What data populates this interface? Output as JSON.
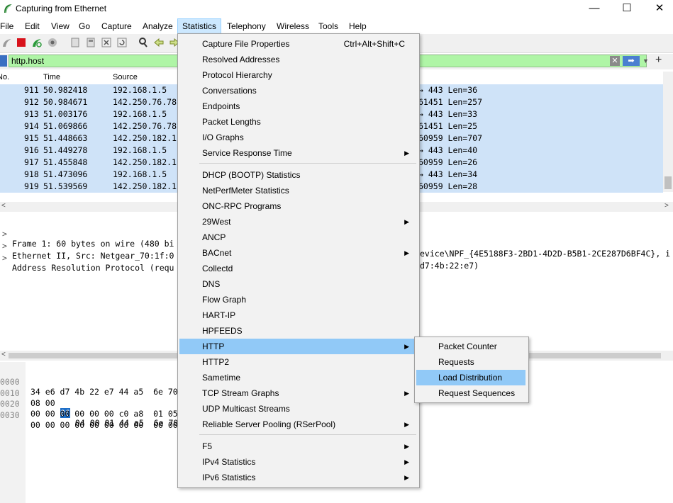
{
  "window": {
    "title": "Capturing from Ethernet",
    "minimize": "—",
    "maximize": "☐",
    "close": "✕"
  },
  "menubar": [
    "File",
    "Edit",
    "View",
    "Go",
    "Capture",
    "Analyze",
    "Statistics",
    "Telephony",
    "Wireless",
    "Tools",
    "Help"
  ],
  "filter": {
    "value": "http.host",
    "plus": "+"
  },
  "packet_list": {
    "headers": [
      "No.",
      "Time",
      "Source"
    ],
    "rows": [
      {
        "no": "911",
        "time": "50.982418",
        "src": "192.168.1.5",
        "info": "→ 443 Len=36"
      },
      {
        "no": "912",
        "time": "50.984671",
        "src": "142.250.76.78",
        "info": "61451 Len=257"
      },
      {
        "no": "913",
        "time": "51.003176",
        "src": "192.168.1.5",
        "info": "→ 443 Len=33"
      },
      {
        "no": "914",
        "time": "51.069866",
        "src": "142.250.76.78",
        "info": "61451 Len=25"
      },
      {
        "no": "915",
        "time": "51.448663",
        "src": "142.250.182.1",
        "info": "60959 Len=707"
      },
      {
        "no": "916",
        "time": "51.449278",
        "src": "192.168.1.5",
        "info": "→ 443 Len=40"
      },
      {
        "no": "917",
        "time": "51.455848",
        "src": "142.250.182.1",
        "info": "60959 Len=26"
      },
      {
        "no": "918",
        "time": "51.473096",
        "src": "192.168.1.5",
        "info": "→ 443 Len=34"
      },
      {
        "no": "919",
        "time": "51.539569",
        "src": "142.250.182.1",
        "info": "60959 Len=28"
      }
    ]
  },
  "details": [
    {
      "left": "Frame 1: 60 bytes on wire (480 bi",
      "right": "evice\\NPF_{4E5188F3-2BD1-4D2D-B5B1-2CE287D6BF4C}, i"
    },
    {
      "left": "Ethernet II, Src: Netgear_70:1f:0",
      "right": "d7:4b:22:e7)"
    },
    {
      "left": "Address Resolution Protocol (requ",
      "right": ""
    }
  ],
  "bytes": [
    {
      "offset": "0000",
      "hex": "34 e6 d7 4b 22 e7 44 a5  6e 70"
    },
    {
      "offset": "0010",
      "hex_pre": "08 00 ",
      "hex_sel": "06",
      "hex_post": " 04 00 01 44 a5  6e 70"
    },
    {
      "offset": "0020",
      "hex": "00 00 00 00 00 00 c0 a8  01 05"
    },
    {
      "offset": "0030",
      "hex": "00 00 00 00 00 00 00 00  00 00"
    }
  ],
  "stats_menu": {
    "items": [
      {
        "label": "Capture File Properties",
        "shortcut": "Ctrl+Alt+Shift+C"
      },
      {
        "label": "Resolved Addresses"
      },
      {
        "label": "Protocol Hierarchy"
      },
      {
        "label": "Conversations"
      },
      {
        "label": "Endpoints"
      },
      {
        "label": "Packet Lengths"
      },
      {
        "label": "I/O Graphs"
      },
      {
        "label": "Service Response Time",
        "submenu": true
      },
      {
        "label": "DHCP (BOOTP) Statistics"
      },
      {
        "label": "NetPerfMeter Statistics"
      },
      {
        "label": "ONC-RPC Programs"
      },
      {
        "label": "29West",
        "submenu": true
      },
      {
        "label": "ANCP"
      },
      {
        "label": "BACnet",
        "submenu": true
      },
      {
        "label": "Collectd"
      },
      {
        "label": "DNS"
      },
      {
        "label": "Flow Graph"
      },
      {
        "label": "HART-IP"
      },
      {
        "label": "HPFEEDS"
      },
      {
        "label": "HTTP",
        "submenu": true
      },
      {
        "label": "HTTP2"
      },
      {
        "label": "Sametime"
      },
      {
        "label": "TCP Stream Graphs",
        "submenu": true
      },
      {
        "label": "UDP Multicast Streams"
      },
      {
        "label": "Reliable Server Pooling (RSerPool)",
        "submenu": true
      },
      {
        "label": "F5",
        "submenu": true
      },
      {
        "label": "IPv4 Statistics",
        "submenu": true
      },
      {
        "label": "IPv6 Statistics",
        "submenu": true
      }
    ]
  },
  "http_submenu": [
    "Packet Counter",
    "Requests",
    "Load Distribution",
    "Request Sequences"
  ],
  "colors": {
    "selected_row": "#cfe3f8",
    "filter_bg": "#aff5a6",
    "menu_highlight": "#91c9f7"
  }
}
